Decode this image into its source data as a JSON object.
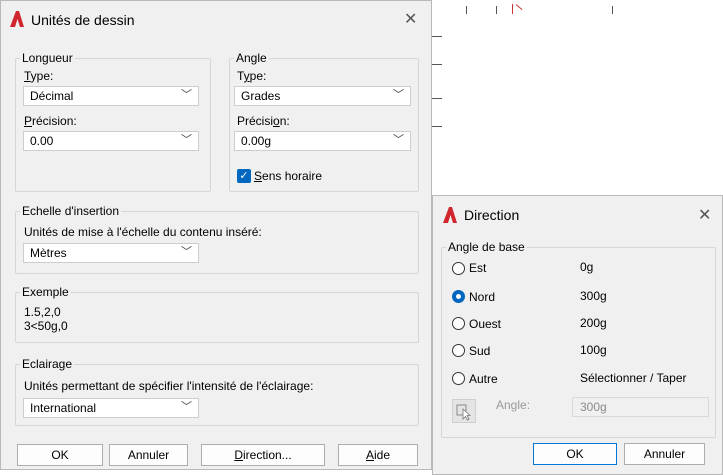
{
  "main_dialog": {
    "title": "Unités de dessin",
    "length": {
      "legend": "Longueur",
      "type_label": "Type:",
      "type_value": "Décimal",
      "precision_label": "Précision:",
      "precision_value": "0.00"
    },
    "angle": {
      "legend": "Angle",
      "type_label": "Type:",
      "type_value": "Grades",
      "precision_label": "Précision:",
      "precision_value": "0.00g",
      "clockwise_label": "Sens horaire",
      "clockwise_checked": true
    },
    "insertion_scale": {
      "legend": "Echelle d'insertion",
      "units_label": "Unités de mise à l'échelle du contenu inséré:",
      "units_value": "Mètres"
    },
    "sample": {
      "legend": "Exemple",
      "line1": "1.5,2,0",
      "line2": "3<50g,0"
    },
    "lighting": {
      "legend": "Eclairage",
      "units_label": "Unités permettant de spécifier l'intensité de l'éclairage:",
      "units_value": "International"
    },
    "buttons": {
      "ok": "OK",
      "cancel": "Annuler",
      "direction": "Direction...",
      "help": "Aide"
    }
  },
  "direction_dialog": {
    "title": "Direction",
    "legend": "Angle de base",
    "options": [
      {
        "label": "Est",
        "value": "0g",
        "selected": false
      },
      {
        "label": "Nord",
        "value": "300g",
        "selected": true
      },
      {
        "label": "Ouest",
        "value": "200g",
        "selected": false
      },
      {
        "label": "Sud",
        "value": "100g",
        "selected": false
      },
      {
        "label": "Autre",
        "value": "Sélectionner / Taper",
        "selected": false
      }
    ],
    "angle_label": "Angle:",
    "angle_value": "300g",
    "buttons": {
      "ok": "OK",
      "cancel": "Annuler"
    }
  },
  "colors": {
    "accent": "#0067c0",
    "logo": "#d0262d",
    "dialog_bg": "#f0f0f0"
  },
  "icons": [
    "autocad-logo-icon",
    "close-icon",
    "chevron-down-icon",
    "pick-angle-icon",
    "checkmark-icon"
  ]
}
